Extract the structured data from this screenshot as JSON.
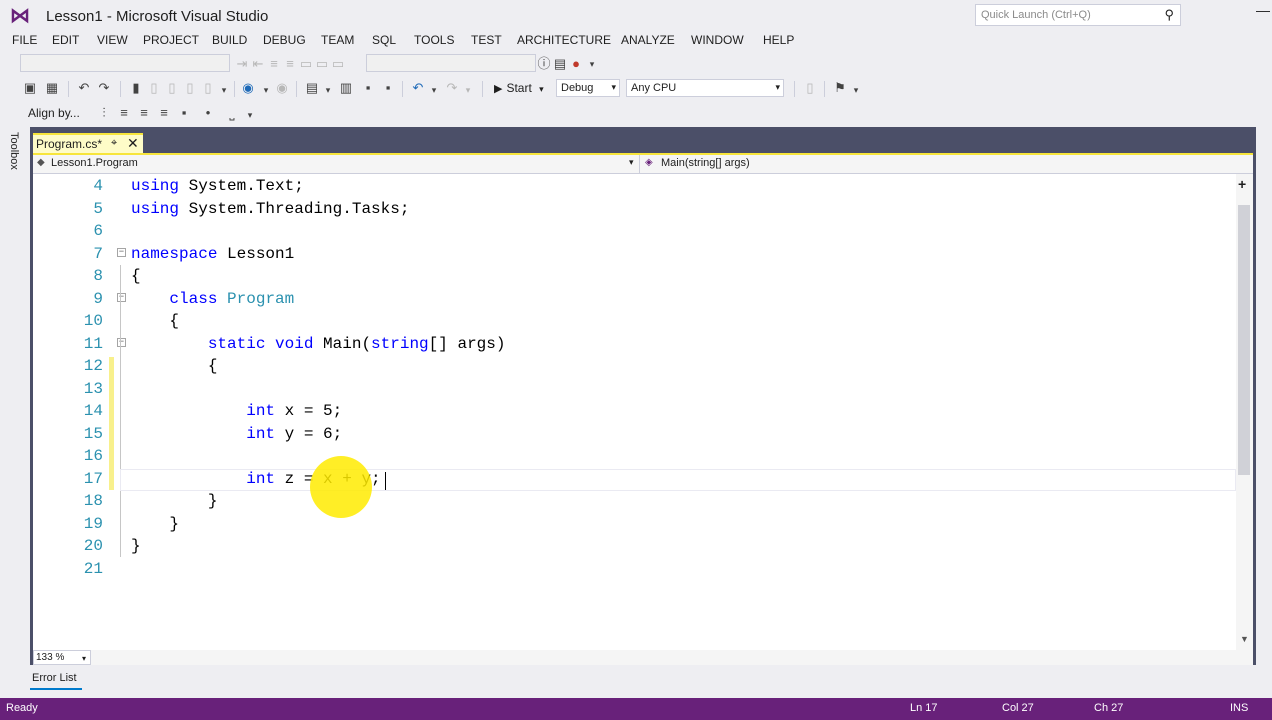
{
  "window": {
    "title": "Lesson1 - Microsoft Visual Studio",
    "quick_launch_placeholder": "Quick Launch (Ctrl+Q)",
    "minimize_glyph": "—"
  },
  "menu": [
    "FILE",
    "EDIT",
    "VIEW",
    "PROJECT",
    "BUILD",
    "DEBUG",
    "TEAM",
    "SQL",
    "TOOLS",
    "TEST",
    "ARCHITECTURE",
    "ANALYZE",
    "WINDOW",
    "HELP"
  ],
  "toolbar": {
    "start_label": "Start",
    "configuration": "Debug",
    "platform": "Any CPU",
    "align_label": "Align by..."
  },
  "toolbox_label": "Toolbox",
  "document_tab": {
    "label": "Program.cs*",
    "pin": "⌖",
    "close": "✕"
  },
  "navbar": {
    "type_scope": "Lesson1.Program",
    "member_scope": "Main(string[] args)"
  },
  "code_lines": [
    {
      "num": "4",
      "tokens": [
        {
          "t": "using",
          "c": "kw"
        },
        {
          "t": " System.Text;",
          "c": ""
        }
      ]
    },
    {
      "num": "5",
      "tokens": [
        {
          "t": "using",
          "c": "kw"
        },
        {
          "t": " System.Threading.Tasks;",
          "c": ""
        }
      ]
    },
    {
      "num": "6",
      "tokens": []
    },
    {
      "num": "7",
      "fold": true,
      "tokens": [
        {
          "t": "namespace",
          "c": "kw"
        },
        {
          "t": " Lesson1",
          "c": ""
        }
      ]
    },
    {
      "num": "8",
      "tokens": [
        {
          "t": "{",
          "c": ""
        }
      ]
    },
    {
      "num": "9",
      "fold": true,
      "tokens": [
        {
          "t": "    ",
          "c": ""
        },
        {
          "t": "class",
          "c": "kw"
        },
        {
          "t": " ",
          "c": ""
        },
        {
          "t": "Program",
          "c": "ty"
        }
      ]
    },
    {
      "num": "10",
      "tokens": [
        {
          "t": "    {",
          "c": ""
        }
      ]
    },
    {
      "num": "11",
      "fold": true,
      "tokens": [
        {
          "t": "        ",
          "c": ""
        },
        {
          "t": "static",
          "c": "kw"
        },
        {
          "t": " ",
          "c": ""
        },
        {
          "t": "void",
          "c": "kw"
        },
        {
          "t": " Main(",
          "c": ""
        },
        {
          "t": "string",
          "c": "kw"
        },
        {
          "t": "[] args)",
          "c": ""
        }
      ]
    },
    {
      "num": "12",
      "tokens": [
        {
          "t": "        {",
          "c": ""
        }
      ]
    },
    {
      "num": "13",
      "tokens": []
    },
    {
      "num": "14",
      "tokens": [
        {
          "t": "            ",
          "c": ""
        },
        {
          "t": "int",
          "c": "kw"
        },
        {
          "t": " x = 5;",
          "c": ""
        }
      ]
    },
    {
      "num": "15",
      "tokens": [
        {
          "t": "            ",
          "c": ""
        },
        {
          "t": "int",
          "c": "kw"
        },
        {
          "t": " y = 6;",
          "c": ""
        }
      ]
    },
    {
      "num": "16",
      "tokens": []
    },
    {
      "num": "17",
      "tokens": [
        {
          "t": "            ",
          "c": ""
        },
        {
          "t": "int",
          "c": "kw"
        },
        {
          "t": " z = x + y;",
          "c": ""
        }
      ]
    },
    {
      "num": "18",
      "tokens": [
        {
          "t": "        }",
          "c": ""
        }
      ]
    },
    {
      "num": "19",
      "tokens": [
        {
          "t": "    }",
          "c": ""
        }
      ]
    },
    {
      "num": "20",
      "tokens": [
        {
          "t": "}",
          "c": ""
        }
      ]
    },
    {
      "num": "21",
      "tokens": []
    }
  ],
  "zoom": "133 %",
  "error_list_tab": "Error List",
  "status": {
    "state": "Ready",
    "line": "Ln 17",
    "col": "Col 27",
    "ch": "Ch 27",
    "mode": "INS"
  },
  "colors": {
    "status_bar": "#68217a",
    "keyword": "#0000ff",
    "type": "#2b91af",
    "line_number": "#2b91af",
    "tab_accent": "#f7e53b"
  }
}
